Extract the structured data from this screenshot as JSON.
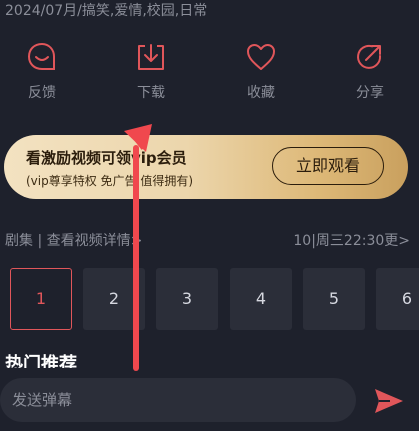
{
  "meta": {
    "info": "2024/07月/搞笑,爱情,校园,日常"
  },
  "actions": [
    {
      "label": "反馈",
      "icon": "feedback-icon"
    },
    {
      "label": "下载",
      "icon": "download-icon"
    },
    {
      "label": "收藏",
      "icon": "heart-icon"
    },
    {
      "label": "分享",
      "icon": "share-icon"
    }
  ],
  "vip": {
    "title": "看激励视频可领vip会员",
    "subtitle": "(vip尊享特权 免广告 值得拥有)",
    "button": "立即观看"
  },
  "episodes_header": {
    "left": "剧集 | 查看视频详情>",
    "right": "10|周三22:30更>"
  },
  "episodes": [
    "1",
    "2",
    "3",
    "4",
    "5",
    "6"
  ],
  "hot": {
    "title": "热门推荐"
  },
  "danmu": {
    "placeholder": "发送弹幕"
  },
  "colors": {
    "background": "#1e212c",
    "accent": "#e0565a",
    "tile": "#2b2e39",
    "vip_gold": "#ddb877"
  }
}
